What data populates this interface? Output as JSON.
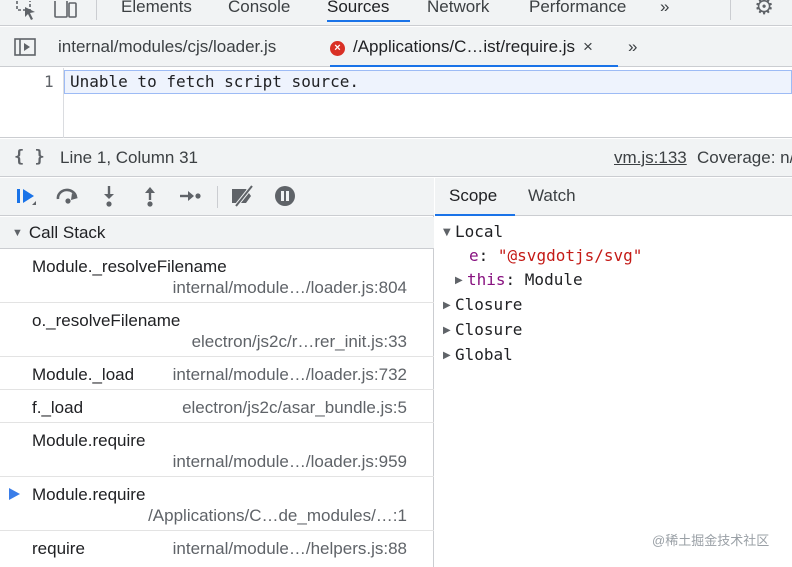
{
  "toolbar": {
    "tabs": [
      {
        "label": "Elements",
        "active": false
      },
      {
        "label": "Console",
        "active": false
      },
      {
        "label": "Sources",
        "active": true
      },
      {
        "label": "Network",
        "active": false
      },
      {
        "label": "Performance",
        "active": false
      }
    ],
    "more_label": "»",
    "icons": [
      "inspect-element-icon",
      "device-toolbar-icon",
      "settings-gear-icon"
    ]
  },
  "file_tabs": {
    "tabs": [
      {
        "label": "internal/modules/cjs/loader.js",
        "active": false
      },
      {
        "label": "/Applications/C…ist/require.js",
        "active": true,
        "error": true
      }
    ],
    "close_label": "×",
    "more_label": "»"
  },
  "editor": {
    "line_number": "1",
    "code": "Unable to fetch script source."
  },
  "status_bar": {
    "braces": "{ }",
    "position": "Line 1, Column 31",
    "source_link": "vm.js:133",
    "coverage": "Coverage: n/a"
  },
  "debugger": {
    "call_stack_title": "Call Stack",
    "frames": [
      {
        "name": "Module._resolveFilename",
        "location": "internal/module…/loader.js:804",
        "current": false
      },
      {
        "name": "o._resolveFilename",
        "location": "electron/js2c/r…rer_init.js:33",
        "current": false
      },
      {
        "name": "Module._load",
        "location": "internal/module…/loader.js:732",
        "current": false
      },
      {
        "name": "f._load",
        "location": "electron/js2c/asar_bundle.js:5",
        "current": false
      },
      {
        "name": "Module.require",
        "location": "internal/module…/loader.js:959",
        "current": false
      },
      {
        "name": "Module.require",
        "location": "/Applications/C…de_modules/…:1",
        "current": true
      },
      {
        "name": "require",
        "location": "internal/module…/helpers.js:88",
        "current": false
      }
    ]
  },
  "scope": {
    "tabs": [
      {
        "label": "Scope",
        "active": true
      },
      {
        "label": "Watch",
        "active": false
      }
    ],
    "local": {
      "label": "Local",
      "e_key": "e",
      "e_value": "\"@svgdotjs/svg\"",
      "this_key": "this",
      "this_value": "Module"
    },
    "closure1": "Closure",
    "closure2": "Closure",
    "global": "Global"
  },
  "watermark": "@稀土掘金技术社区",
  "colors": {
    "accent": "#1a73e8",
    "error": "#d93025",
    "property": "#881280",
    "string": "#c41a16"
  }
}
